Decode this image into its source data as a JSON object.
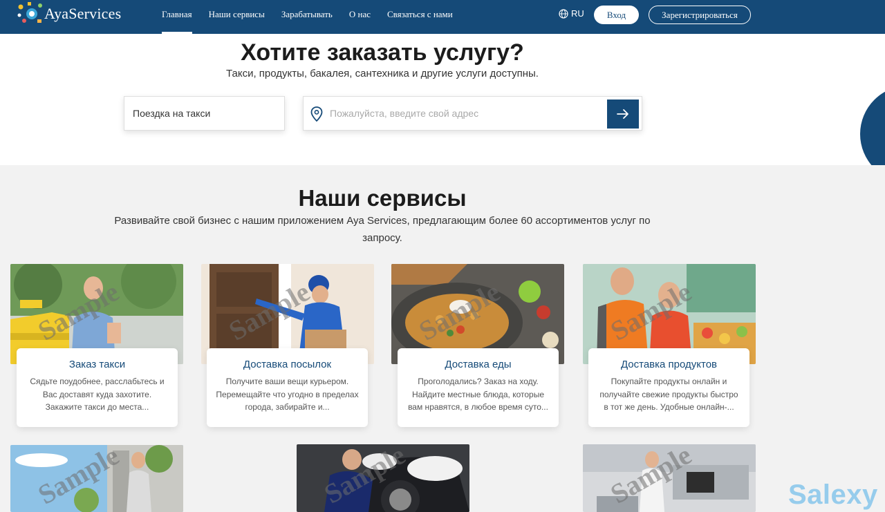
{
  "header": {
    "logo_text": "AyaServices",
    "nav": [
      {
        "label": "Главная",
        "active": true
      },
      {
        "label": "Наши сервисы"
      },
      {
        "label": "Зарабатывать"
      },
      {
        "label": "О нас"
      },
      {
        "label": "Связаться с нами"
      }
    ],
    "language": "RU",
    "login_label": "Вход",
    "register_label": "Зарегистрироваться"
  },
  "hero": {
    "title": "Хотите заказать услугу?",
    "subtitle": "Такси, продукты, бакалея, сантехника и другие услуги доступны.",
    "service_select": "Поездка на такси",
    "address_placeholder": "Пожалуйста, введите свой адрес"
  },
  "services": {
    "title": "Наши сервисы",
    "description": "Развивайте свой бизнес с нашим приложением Aya Services, предлагающим более 60 ассортиментов услуг по запросу.",
    "watermark": "Sample",
    "cards": [
      {
        "title": "Заказ такси",
        "text": "Сядьте поудобнее, расслабьтесь и Вас доставят куда захотите. Закажите такси до места..."
      },
      {
        "title": "Доставка посылок",
        "text": "Получите ваши вещи курьером. Перемещайте что угодно в пределах города, забирайте и..."
      },
      {
        "title": "Доставка еды",
        "text": "Проголодались? Заказ на ходу. Найдите местные блюда, которые вам нравятся, в любое время суто..."
      },
      {
        "title": "Доставка продуктов",
        "text": "Покупайте продукты онлайн и получайте свежие продукты быстро в тот же день. Удобные онлайн-..."
      }
    ]
  },
  "site_watermark": "Salexy",
  "colors": {
    "primary": "#154a78",
    "background": "#f2f2f2",
    "card_title": "#154a78"
  },
  "icons": [
    "globe-icon",
    "location-pin-icon",
    "arrow-right-icon"
  ]
}
